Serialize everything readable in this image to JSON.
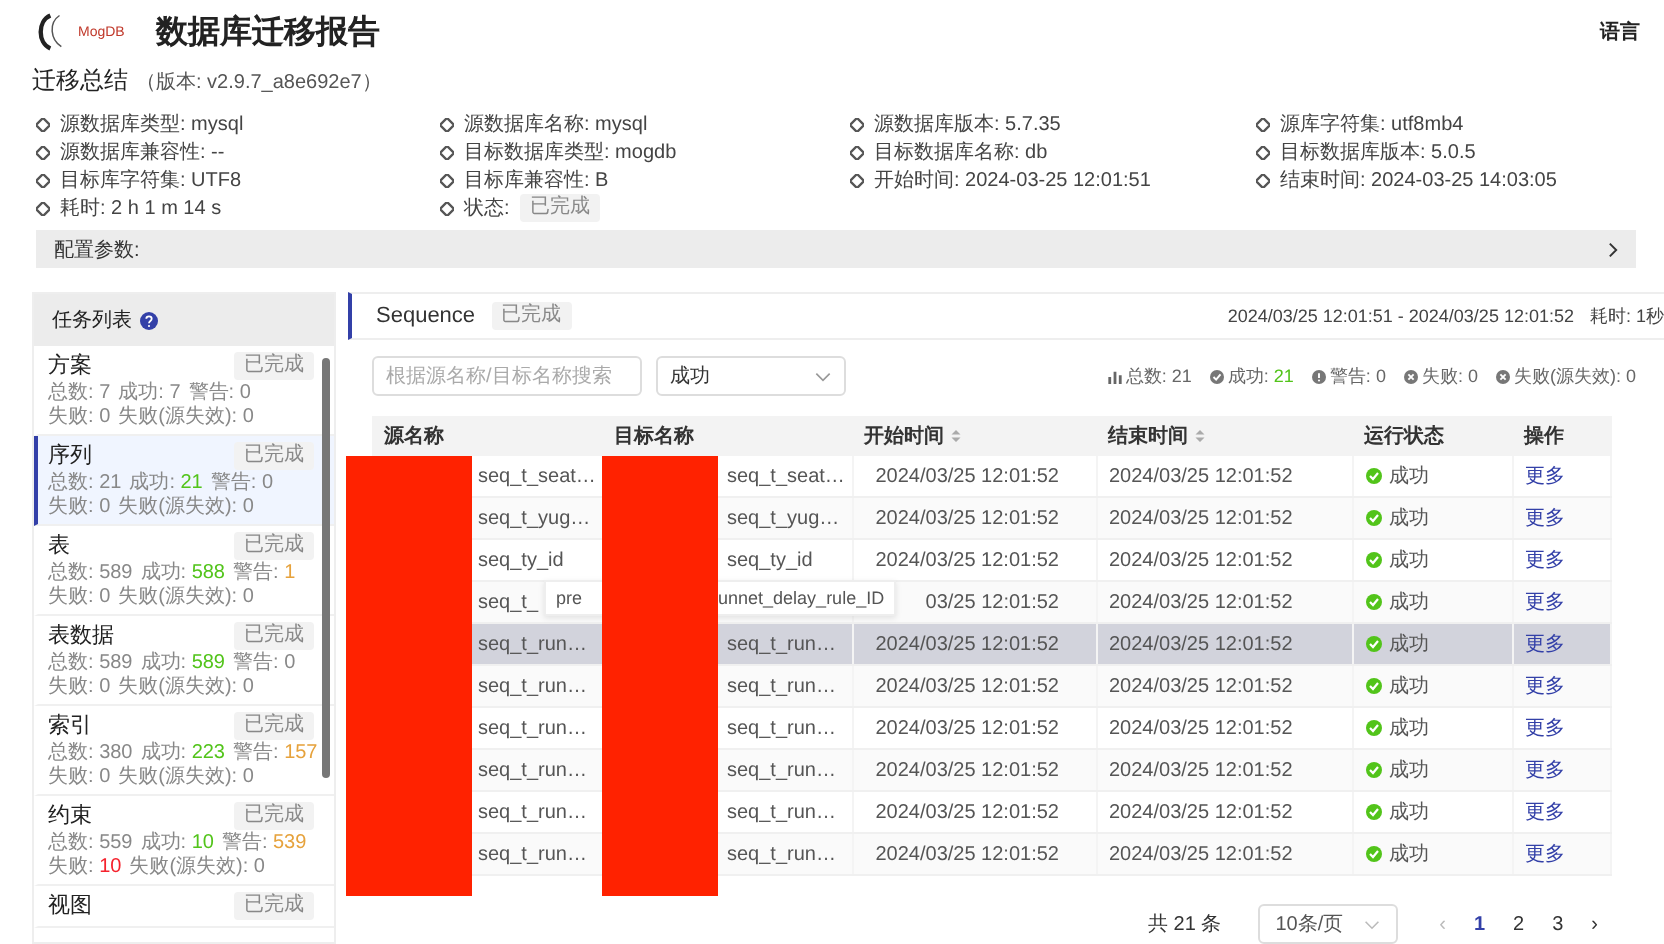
{
  "header": {
    "logo_text": "MogDB",
    "title": "数据库迁移报告",
    "language": "语言"
  },
  "summary": {
    "title": "迁移总结",
    "version": "（版本: v2.9.7_a8e692e7）",
    "items": [
      {
        "label": "源数据库类型:",
        "value": "mysql",
        "kind": "text"
      },
      {
        "label": "源数据库名称:",
        "value": "mysql",
        "kind": "text"
      },
      {
        "label": "源数据库版本:",
        "value": "5.7.35",
        "kind": "text"
      },
      {
        "label": "源库字符集:",
        "value": "utf8mb4",
        "kind": "text"
      },
      {
        "label": "源数据库兼容性:",
        "value": "--",
        "kind": "text"
      },
      {
        "label": "目标数据库类型:",
        "value": "mogdb",
        "kind": "text"
      },
      {
        "label": "目标数据库名称:",
        "value": "db",
        "kind": "text"
      },
      {
        "label": "目标数据库版本:",
        "value": "5.0.5",
        "kind": "text"
      },
      {
        "label": "目标库字符集:",
        "value": "UTF8",
        "kind": "text"
      },
      {
        "label": "目标库兼容性:",
        "value": "B",
        "kind": "text"
      },
      {
        "label": "开始时间:",
        "value": "2024-03-25 12:01:51",
        "kind": "text"
      },
      {
        "label": "结束时间:",
        "value": "2024-03-25 14:03:05",
        "kind": "text"
      },
      {
        "label": "耗时:",
        "value": "2 h 1 m 14 s",
        "kind": "text"
      },
      {
        "label": "状态:",
        "value": "已完成",
        "kind": "badge"
      }
    ],
    "config": {
      "label": "配置参数:",
      "expanded": false
    }
  },
  "task_list": {
    "title": "任务列表",
    "items": [
      {
        "name": "方案",
        "badge": "已完成",
        "selected": false,
        "stats": [
          [
            {
              "label": "总数:",
              "value": "7"
            },
            {
              "label": "成功:",
              "value": "7"
            },
            {
              "label": "警告:",
              "value": "0"
            }
          ],
          [
            {
              "label": "失败:",
              "value": "0"
            },
            {
              "label": "失败(源失效):",
              "value": "0"
            }
          ]
        ]
      },
      {
        "name": "序列",
        "badge": "已完成",
        "selected": true,
        "stats": [
          [
            {
              "label": "总数:",
              "value": "21"
            },
            {
              "label": "成功:",
              "value": "21",
              "color": "#52c41a"
            },
            {
              "label": "警告:",
              "value": "0"
            }
          ],
          [
            {
              "label": "失败:",
              "value": "0"
            },
            {
              "label": "失败(源失效):",
              "value": "0"
            }
          ]
        ]
      },
      {
        "name": "表",
        "badge": "已完成",
        "selected": false,
        "stats": [
          [
            {
              "label": "总数:",
              "value": "589"
            },
            {
              "label": "成功:",
              "value": "588",
              "color": "#52c41a"
            },
            {
              "label": "警告:",
              "value": "1",
              "color": "#e6a23c"
            }
          ],
          [
            {
              "label": "失败:",
              "value": "0"
            },
            {
              "label": "失败(源失效):",
              "value": "0"
            }
          ]
        ]
      },
      {
        "name": "表数据",
        "badge": "已完成",
        "selected": false,
        "stats": [
          [
            {
              "label": "总数:",
              "value": "589"
            },
            {
              "label": "成功:",
              "value": "589",
              "color": "#52c41a"
            },
            {
              "label": "警告:",
              "value": "0"
            }
          ],
          [
            {
              "label": "失败:",
              "value": "0"
            },
            {
              "label": "失败(源失效):",
              "value": "0"
            }
          ]
        ]
      },
      {
        "name": "索引",
        "badge": "已完成",
        "selected": false,
        "stats": [
          [
            {
              "label": "总数:",
              "value": "380"
            },
            {
              "label": "成功:",
              "value": "223",
              "color": "#52c41a"
            },
            {
              "label": "警告:",
              "value": "157",
              "color": "#e6a23c"
            }
          ],
          [
            {
              "label": "失败:",
              "value": "0"
            },
            {
              "label": "失败(源失效):",
              "value": "0"
            }
          ]
        ]
      },
      {
        "name": "约束",
        "badge": "已完成",
        "selected": false,
        "stats": [
          [
            {
              "label": "总数:",
              "value": "559"
            },
            {
              "label": "成功:",
              "value": "10",
              "color": "#52c41a"
            },
            {
              "label": "警告:",
              "value": "539",
              "color": "#e6a23c"
            }
          ],
          [
            {
              "label": "失败:",
              "value": "10",
              "color": "#f5222d"
            },
            {
              "label": "失败(源失效):",
              "value": "0"
            }
          ]
        ]
      },
      {
        "name": "视图",
        "badge": "已完成",
        "selected": false
      }
    ]
  },
  "detail": {
    "title": "Sequence",
    "badge": "已完成",
    "time_range": "2024/03/25 12:01:51 - 2024/03/25 12:01:52",
    "duration": "耗时: 1秒",
    "search": {
      "placeholder": "根据源名称/目标名称搜索"
    },
    "filter": {
      "value": "成功"
    },
    "summary": [
      {
        "kind": "total",
        "label": "总数:",
        "value": "21"
      },
      {
        "kind": "success",
        "label": "成功:",
        "value": "21"
      },
      {
        "kind": "warning",
        "label": "警告:",
        "value": "0"
      },
      {
        "kind": "failure",
        "label": "失败:",
        "value": "0"
      },
      {
        "kind": "failure",
        "label": "失败(源失效):",
        "value": "0"
      }
    ],
    "table": {
      "columns": [
        {
          "label": "源名称",
          "sortable": false
        },
        {
          "label": "目标名称",
          "sortable": false
        },
        {
          "label": "开始时间",
          "sortable": true
        },
        {
          "label": "结束时间",
          "sortable": true
        },
        {
          "label": "运行状态",
          "sortable": false
        },
        {
          "label": "操作",
          "sortable": false
        }
      ],
      "rows": [
        {
          "source": "seq_t_seat…",
          "target": "seq_t_seat…",
          "start": "2024/03/25 12:01:52",
          "end": "2024/03/25 12:01:52",
          "status": {
            "kind": "success",
            "text": "成功"
          },
          "action": "更多",
          "hovered": false
        },
        {
          "source": "seq_t_yug…",
          "target": "seq_t_yug…",
          "start": "2024/03/25 12:01:52",
          "end": "2024/03/25 12:01:52",
          "status": {
            "kind": "success",
            "text": "成功"
          },
          "action": "更多",
          "hovered": false
        },
        {
          "source": "seq_ty_id",
          "target": "seq_ty_id",
          "start": "2024/03/25 12:01:52",
          "end": "2024/03/25 12:01:52",
          "status": {
            "kind": "success",
            "text": "成功"
          },
          "action": "更多",
          "hovered": false
        },
        {
          "source": "seq_t_",
          "start": "03/25 12:01:52",
          "end": "2024/03/25 12:01:52",
          "status": {
            "kind": "success",
            "text": "成功"
          },
          "action": "更多",
          "hovered": false,
          "tooltip": [
            "pre",
            "unnet_delay_rule_ID"
          ]
        },
        {
          "source": "seq_t_run…",
          "target": "seq_t_run…",
          "start": "2024/03/25 12:01:52",
          "end": "2024/03/25 12:01:52",
          "status": {
            "kind": "success",
            "text": "成功"
          },
          "action": "更多",
          "hovered": true
        },
        {
          "source": "seq_t_run…",
          "target": "seq_t_run…",
          "start": "2024/03/25 12:01:52",
          "end": "2024/03/25 12:01:52",
          "status": {
            "kind": "success",
            "text": "成功"
          },
          "action": "更多",
          "hovered": false
        },
        {
          "source": "seq_t_run…",
          "target": "seq_t_run…",
          "start": "2024/03/25 12:01:52",
          "end": "2024/03/25 12:01:52",
          "status": {
            "kind": "success",
            "text": "成功"
          },
          "action": "更多",
          "hovered": false
        },
        {
          "source": "seq_t_run…",
          "target": "seq_t_run…",
          "start": "2024/03/25 12:01:52",
          "end": "2024/03/25 12:01:52",
          "status": {
            "kind": "success",
            "text": "成功"
          },
          "action": "更多",
          "hovered": false
        },
        {
          "source": "seq_t_run…",
          "target": "seq_t_run…",
          "start": "2024/03/25 12:01:52",
          "end": "2024/03/25 12:01:52",
          "status": {
            "kind": "success",
            "text": "成功"
          },
          "action": "更多",
          "hovered": false
        },
        {
          "source": "seq_t_run…",
          "target": "seq_t_run…",
          "start": "2024/03/25 12:01:52",
          "end": "2024/03/25 12:01:52",
          "status": {
            "kind": "success",
            "text": "成功"
          },
          "action": "更多",
          "hovered": false
        }
      ]
    },
    "pagination": {
      "total": "共 21 条",
      "page_size": "10条/页",
      "prev": "‹",
      "next": "›",
      "pages": [
        {
          "label": "1",
          "selected": true
        },
        {
          "label": "2",
          "selected": false
        },
        {
          "label": "3",
          "selected": false
        }
      ]
    }
  }
}
